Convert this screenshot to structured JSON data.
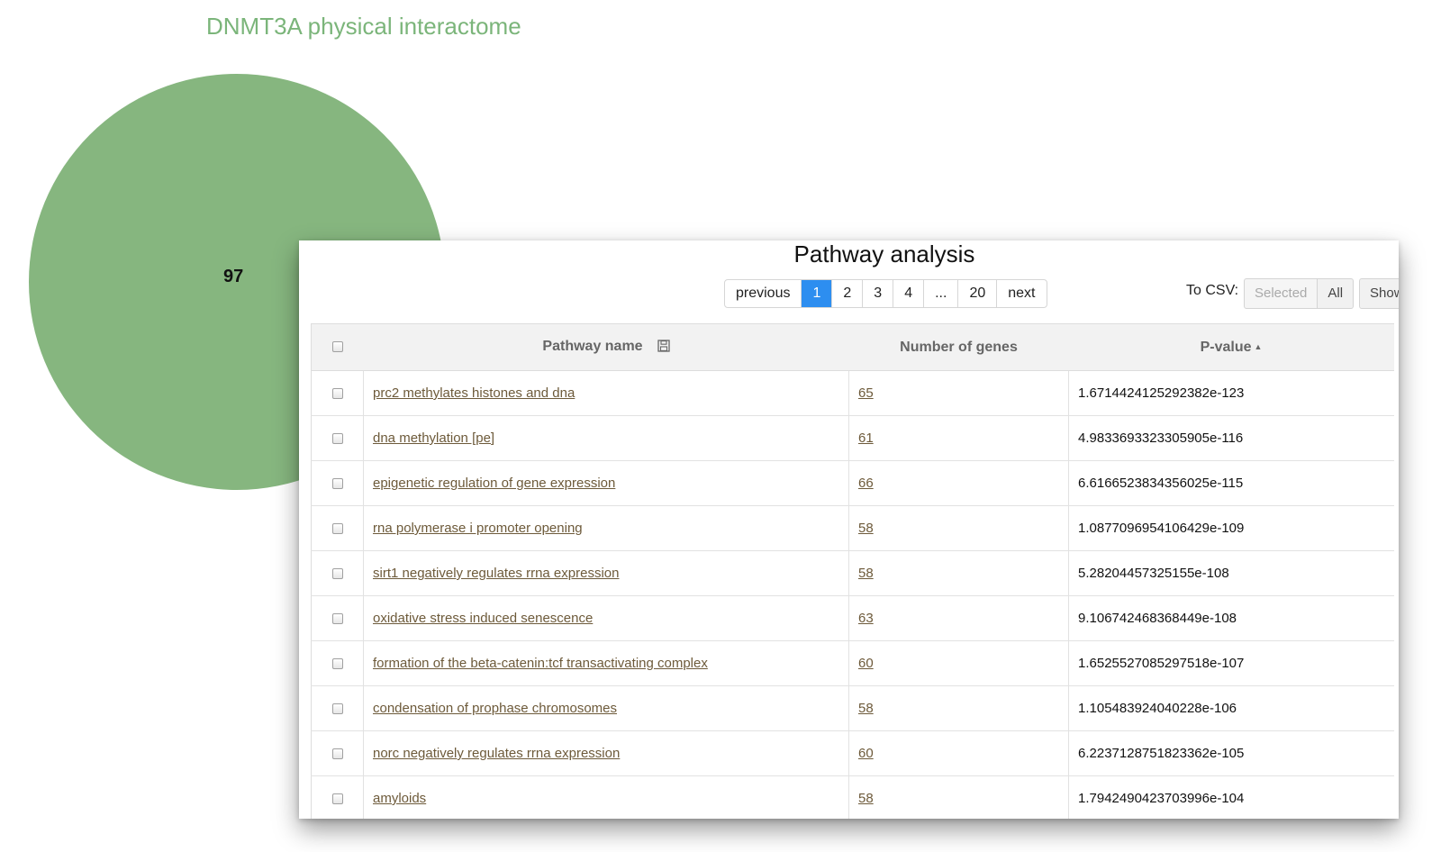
{
  "venn": {
    "title": "DNMT3A physical interactome",
    "count": "97",
    "color": "#86b67f"
  },
  "panel": {
    "title": "Pathway analysis",
    "pagination": [
      "previous",
      "1",
      "2",
      "3",
      "4",
      "...",
      "20",
      "next"
    ],
    "active_page": "1",
    "csv_label": "To CSV:",
    "csv_buttons": [
      "Selected",
      "All"
    ],
    "show_button": "Show"
  },
  "table": {
    "headers": {
      "pathway": "Pathway name",
      "genes": "Number of genes",
      "pvalue": "P-value"
    },
    "rows": [
      {
        "pathway": "prc2 methylates histones and dna",
        "genes": "65",
        "pvalue": "1.6714424125292382e-123"
      },
      {
        "pathway": "dna methylation [pe]",
        "genes": "61",
        "pvalue": "4.9833693323305905e-116"
      },
      {
        "pathway": "epigenetic regulation of gene expression",
        "genes": "66",
        "pvalue": "6.6166523834356025e-115"
      },
      {
        "pathway": "rna polymerase i promoter opening",
        "genes": "58",
        "pvalue": "1.0877096954106429e-109"
      },
      {
        "pathway": "sirt1 negatively regulates rrna expression",
        "genes": "58",
        "pvalue": "5.28204457325155e-108"
      },
      {
        "pathway": "oxidative stress induced senescence",
        "genes": "63",
        "pvalue": "9.106742468368449e-108"
      },
      {
        "pathway": "formation of the beta-catenin:tcf transactivating complex",
        "genes": "60",
        "pvalue": "1.6525527085297518e-107"
      },
      {
        "pathway": "condensation of prophase chromosomes",
        "genes": "58",
        "pvalue": "1.105483924040228e-106"
      },
      {
        "pathway": "norc negatively regulates rrna expression",
        "genes": "60",
        "pvalue": "6.2237128751823362e-105"
      },
      {
        "pathway": "amyloids",
        "genes": "58",
        "pvalue": "1.7942490423703996e-104"
      }
    ]
  }
}
